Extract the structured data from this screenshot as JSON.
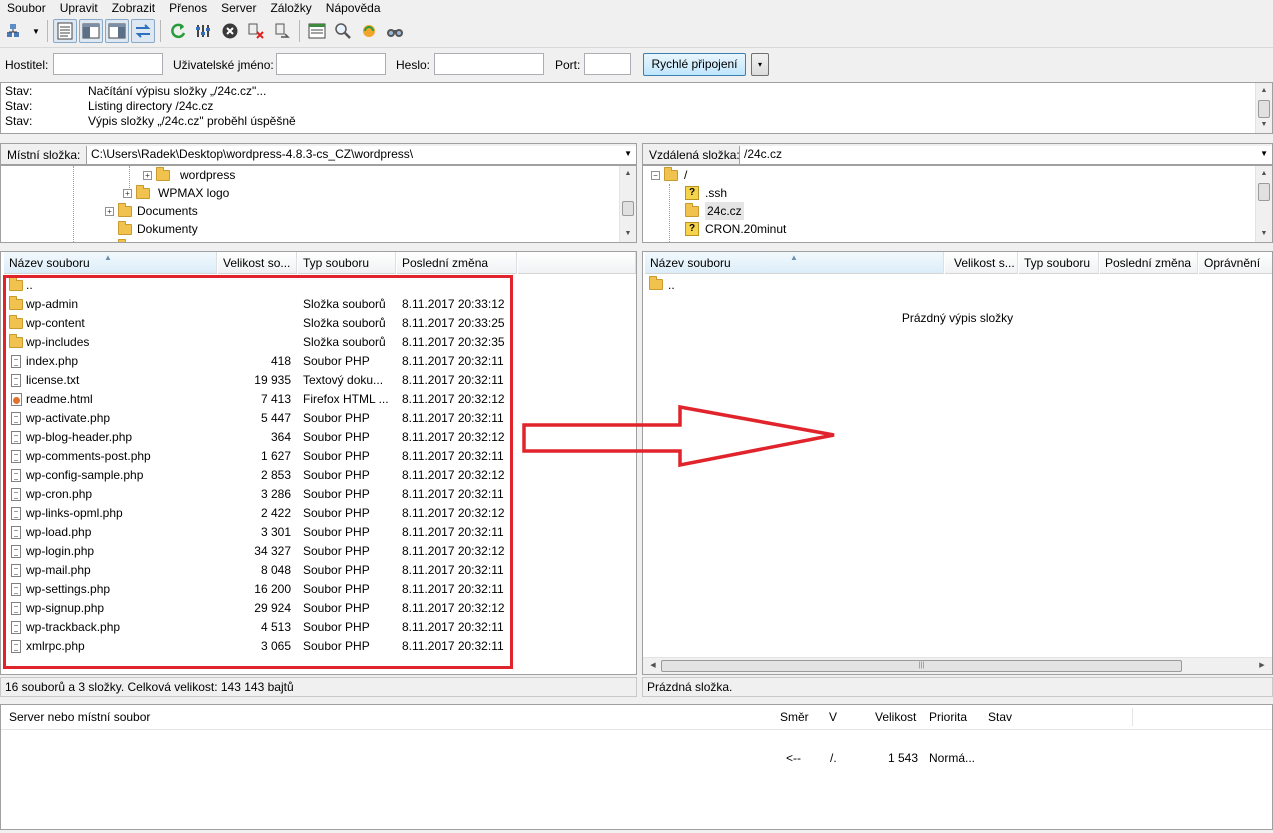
{
  "menu": [
    "Soubor",
    "Upravit",
    "Zobrazit",
    "Přenos",
    "Server",
    "Záložky",
    "Nápověda"
  ],
  "toolbar": {
    "icons": [
      "site-manager-icon",
      "dropdown-arrow-icon",
      "toggle-log-icon",
      "toggle-local-tree-icon",
      "toggle-remote-tree-icon",
      "toggle-queue-icon",
      "refresh-icon",
      "process-queue-icon",
      "cancel-icon",
      "disconnect-icon",
      "reconnect-icon",
      "directory-filter-icon",
      "compare-icon",
      "sync-browse-icon",
      "search-icon"
    ]
  },
  "quickconnect": {
    "host_label": "Hostitel:",
    "host_value": "",
    "user_label": "Uživatelské jméno:",
    "user_value": "",
    "pass_label": "Heslo:",
    "pass_value": "",
    "port_label": "Port:",
    "port_value": "",
    "connect_button": "Rychlé připojení",
    "dropdown": "▾"
  },
  "log": [
    {
      "key": "Stav:",
      "msg": "Načítání výpisu složky „/24c.cz\"..."
    },
    {
      "key": "Stav:",
      "msg": "Listing directory /24c.cz"
    },
    {
      "key": "Stav:",
      "msg": "Výpis složky „/24c.cz\" proběhl úspěšně"
    }
  ],
  "local": {
    "folder_label": "Místní složka:",
    "path": "C:\\Users\\Radek\\Desktop\\wordpress-4.8.3-cs_CZ\\wordpress\\",
    "tree": [
      {
        "label": "wordpress",
        "expand": "+"
      },
      {
        "label": "WPMAX logo",
        "expand": "+"
      },
      {
        "label": "Documents",
        "expand": "+"
      },
      {
        "label": "Dokumenty",
        "expand": ""
      }
    ],
    "columns": [
      "Název souboru",
      "Velikost so...",
      "Typ souboru",
      "Poslední změna"
    ],
    "files": [
      {
        "name": "..",
        "size": "",
        "type": "",
        "modified": "",
        "icon": "folder"
      },
      {
        "name": "wp-admin",
        "size": "",
        "type": "Složka souborů",
        "modified": "8.11.2017 20:33:12",
        "icon": "folder"
      },
      {
        "name": "wp-content",
        "size": "",
        "type": "Složka souborů",
        "modified": "8.11.2017 20:33:25",
        "icon": "folder"
      },
      {
        "name": "wp-includes",
        "size": "",
        "type": "Složka souborů",
        "modified": "8.11.2017 20:32:35",
        "icon": "folder"
      },
      {
        "name": "index.php",
        "size": "418",
        "type": "Soubor PHP",
        "modified": "8.11.2017 20:32:11",
        "icon": "file"
      },
      {
        "name": "license.txt",
        "size": "19 935",
        "type": "Textový doku...",
        "modified": "8.11.2017 20:32:11",
        "icon": "file"
      },
      {
        "name": "readme.html",
        "size": "7 413",
        "type": "Firefox HTML ...",
        "modified": "8.11.2017 20:32:12",
        "icon": "html"
      },
      {
        "name": "wp-activate.php",
        "size": "5 447",
        "type": "Soubor PHP",
        "modified": "8.11.2017 20:32:11",
        "icon": "file"
      },
      {
        "name": "wp-blog-header.php",
        "size": "364",
        "type": "Soubor PHP",
        "modified": "8.11.2017 20:32:12",
        "icon": "file"
      },
      {
        "name": "wp-comments-post.php",
        "size": "1 627",
        "type": "Soubor PHP",
        "modified": "8.11.2017 20:32:11",
        "icon": "file"
      },
      {
        "name": "wp-config-sample.php",
        "size": "2 853",
        "type": "Soubor PHP",
        "modified": "8.11.2017 20:32:12",
        "icon": "file"
      },
      {
        "name": "wp-cron.php",
        "size": "3 286",
        "type": "Soubor PHP",
        "modified": "8.11.2017 20:32:11",
        "icon": "file"
      },
      {
        "name": "wp-links-opml.php",
        "size": "2 422",
        "type": "Soubor PHP",
        "modified": "8.11.2017 20:32:12",
        "icon": "file"
      },
      {
        "name": "wp-load.php",
        "size": "3 301",
        "type": "Soubor PHP",
        "modified": "8.11.2017 20:32:11",
        "icon": "file"
      },
      {
        "name": "wp-login.php",
        "size": "34 327",
        "type": "Soubor PHP",
        "modified": "8.11.2017 20:32:12",
        "icon": "file"
      },
      {
        "name": "wp-mail.php",
        "size": "8 048",
        "type": "Soubor PHP",
        "modified": "8.11.2017 20:32:11",
        "icon": "file"
      },
      {
        "name": "wp-settings.php",
        "size": "16 200",
        "type": "Soubor PHP",
        "modified": "8.11.2017 20:32:11",
        "icon": "file"
      },
      {
        "name": "wp-signup.php",
        "size": "29 924",
        "type": "Soubor PHP",
        "modified": "8.11.2017 20:32:12",
        "icon": "file"
      },
      {
        "name": "wp-trackback.php",
        "size": "4 513",
        "type": "Soubor PHP",
        "modified": "8.11.2017 20:32:11",
        "icon": "file"
      },
      {
        "name": "xmlrpc.php",
        "size": "3 065",
        "type": "Soubor PHP",
        "modified": "8.11.2017 20:32:11",
        "icon": "file"
      }
    ],
    "status": "16 souborů a 3 složky. Celková velikost: 143 143 bajtů"
  },
  "remote": {
    "folder_label": "Vzdálená složka:",
    "path": "/24c.cz",
    "tree": [
      {
        "label": "/",
        "icon": "folder",
        "expand": "−"
      },
      {
        "label": ".ssh",
        "icon": "question"
      },
      {
        "label": "24c.cz",
        "icon": "folder",
        "selected": true
      },
      {
        "label": "CRON.20minut",
        "icon": "question"
      }
    ],
    "columns": [
      "Název souboru",
      "Velikost s...",
      "Typ souboru",
      "Poslední změna",
      "Oprávnění"
    ],
    "files": [
      {
        "name": "..",
        "icon": "folder"
      }
    ],
    "empty_message": "Prázdný výpis složky",
    "status": "Prázdná složka."
  },
  "queue": {
    "columns": [
      "Server nebo místní soubor",
      "Směr",
      "V",
      "Velikost",
      "Priorita",
      "Stav"
    ],
    "row": {
      "file": "",
      "direction": "<--",
      "remote": "/.",
      "size": "1 543",
      "priority": "Normá...",
      "status": ""
    }
  },
  "annotation": {
    "color": "#e1232b"
  }
}
